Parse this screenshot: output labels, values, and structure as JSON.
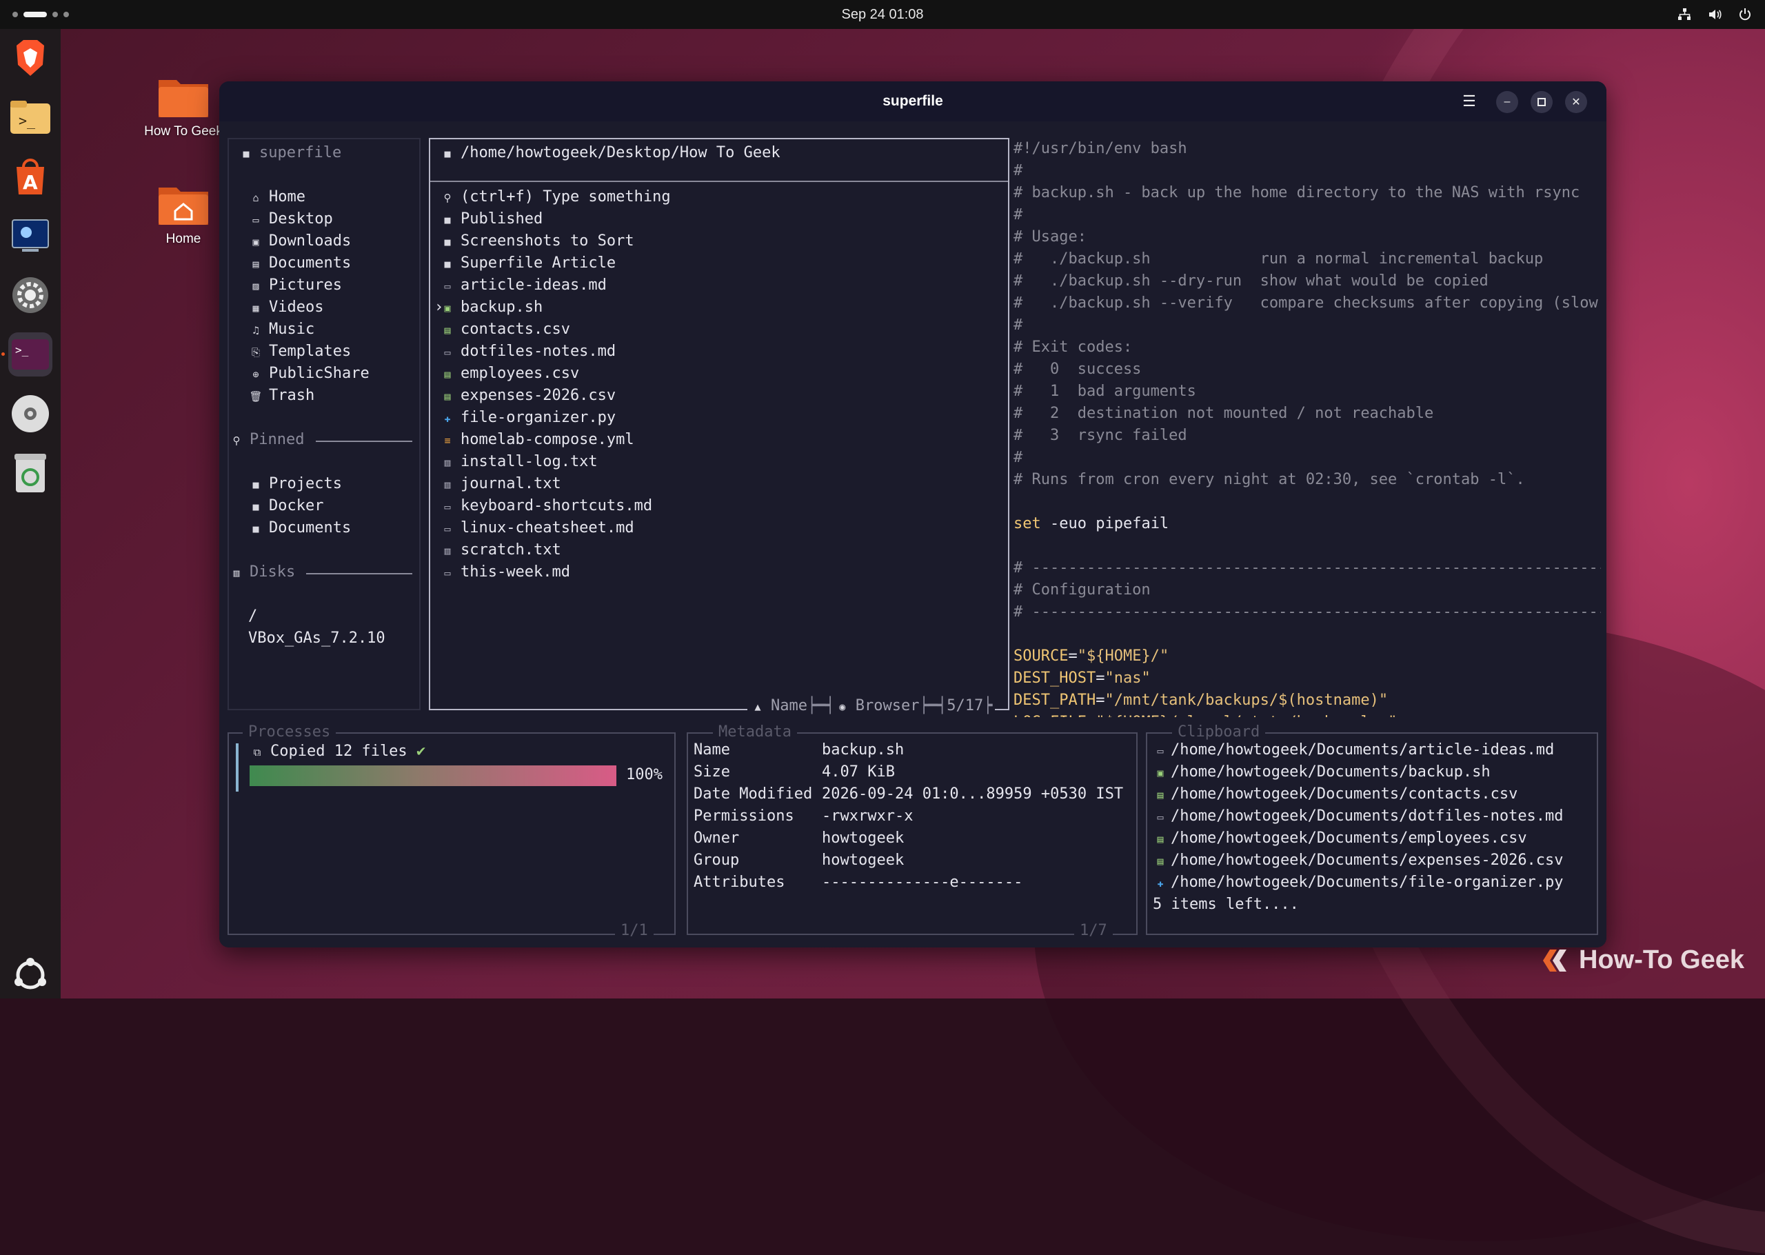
{
  "topbar": {
    "clock": "Sep 24  01:08"
  },
  "desktop": [
    {
      "label": "How To Geek"
    },
    {
      "label": "Home"
    }
  ],
  "window": {
    "title": "superfile"
  },
  "sidebar": {
    "title": "superfile",
    "items": [
      "Home",
      "Desktop",
      "Downloads",
      "Documents",
      "Pictures",
      "Videos",
      "Music",
      "Templates",
      "PublicShare",
      "Trash"
    ],
    "pinned_label": "Pinned",
    "pinned": [
      "Projects",
      "Docker",
      "Documents"
    ],
    "disks_label": "Disks",
    "disks": [
      "/",
      "VBox_GAs_7.2.10"
    ]
  },
  "browser": {
    "path": "/home/howtogeek/Desktop/How To Geek",
    "search_placeholder": "(ctrl+f) Type something",
    "files": [
      {
        "name": "Published",
        "icon": "folder"
      },
      {
        "name": "Screenshots to Sort",
        "icon": "folder"
      },
      {
        "name": "Superfile Article",
        "icon": "folder"
      },
      {
        "name": "article-ideas.md",
        "icon": "markdown"
      },
      {
        "name": "backup.sh",
        "icon": "script",
        "selected": true
      },
      {
        "name": "contacts.csv",
        "icon": "csv"
      },
      {
        "name": "dotfiles-notes.md",
        "icon": "markdown"
      },
      {
        "name": "employees.csv",
        "icon": "csv"
      },
      {
        "name": "expenses-2026.csv",
        "icon": "csv"
      },
      {
        "name": "file-organizer.py",
        "icon": "python"
      },
      {
        "name": "homelab-compose.yml",
        "icon": "yaml"
      },
      {
        "name": "install-log.txt",
        "icon": "text"
      },
      {
        "name": "journal.txt",
        "icon": "text"
      },
      {
        "name": "keyboard-shortcuts.md",
        "icon": "markdown"
      },
      {
        "name": "linux-cheatsheet.md",
        "icon": "markdown"
      },
      {
        "name": "scratch.txt",
        "icon": "text"
      },
      {
        "name": "this-week.md",
        "icon": "markdown"
      }
    ],
    "footer": {
      "sort": "Name",
      "mode": "Browser",
      "count": "5/17"
    }
  },
  "preview": {
    "lines": [
      {
        "t": "#!/usr/bin/env bash",
        "c": "comment"
      },
      {
        "t": "#",
        "c": "comment"
      },
      {
        "t": "# backup.sh - back up the home directory to the NAS with rsync",
        "c": "comment"
      },
      {
        "t": "#",
        "c": "comment"
      },
      {
        "t": "# Usage:",
        "c": "comment"
      },
      {
        "t": "#   ./backup.sh            run a normal incremental backup",
        "c": "comment"
      },
      {
        "t": "#   ./backup.sh --dry-run  show what would be copied",
        "c": "comment"
      },
      {
        "t": "#   ./backup.sh --verify   compare checksums after copying (slow",
        "c": "comment"
      },
      {
        "t": "#",
        "c": "comment"
      },
      {
        "t": "# Exit codes:",
        "c": "comment"
      },
      {
        "t": "#   0  success",
        "c": "comment"
      },
      {
        "t": "#   1  bad arguments",
        "c": "comment"
      },
      {
        "t": "#   2  destination not mounted / not reachable",
        "c": "comment"
      },
      {
        "t": "#   3  rsync failed",
        "c": "comment"
      },
      {
        "t": "#",
        "c": "comment"
      },
      {
        "t": "# Runs from cron every night at 02:30, see `crontab -l`.",
        "c": "comment"
      },
      {
        "t": "",
        "c": "plain"
      },
      {
        "t": "set -euo pipefail",
        "c": "set"
      },
      {
        "t": "",
        "c": "plain"
      },
      {
        "t": "# ---------------------------------------------------------------",
        "c": "comment"
      },
      {
        "t": "# Configuration",
        "c": "comment"
      },
      {
        "t": "# ---------------------------------------------------------------",
        "c": "comment"
      },
      {
        "t": "",
        "c": "plain"
      },
      {
        "t": "SOURCE=\"${HOME}/\"",
        "c": "assign"
      },
      {
        "t": "DEST_HOST=\"nas\"",
        "c": "assign"
      },
      {
        "t": "DEST_PATH=\"/mnt/tank/backups/$(hostname)\"",
        "c": "assign"
      },
      {
        "t": "LOG_FILE=\"${HOME}/.local/state/backup.log\"",
        "c": "assign"
      }
    ]
  },
  "processes": {
    "label": "Processes",
    "task": "Copied 12 files",
    "progress": 1.0,
    "progress_text": "100%",
    "footer": "1/1"
  },
  "metadata": {
    "label": "Metadata",
    "rows": [
      {
        "k": "Name",
        "v": "backup.sh"
      },
      {
        "k": "Size",
        "v": "4.07 KiB"
      },
      {
        "k": "Date Modified",
        "v": "2026-09-24 01:0...89959 +0530 IST"
      },
      {
        "k": "Permissions",
        "v": "-rwxrwxr-x"
      },
      {
        "k": "Owner",
        "v": "howtogeek"
      },
      {
        "k": "Group",
        "v": "howtogeek"
      },
      {
        "k": "Attributes",
        "v": "--------------e-------"
      }
    ],
    "footer": "1/7"
  },
  "clipboard": {
    "label": "Clipboard",
    "items": [
      {
        "t": "/home/howtogeek/Documents/article-ideas.md",
        "icon": "markdown"
      },
      {
        "t": "/home/howtogeek/Documents/backup.sh",
        "icon": "script"
      },
      {
        "t": "/home/howtogeek/Documents/contacts.csv",
        "icon": "csv"
      },
      {
        "t": "/home/howtogeek/Documents/dotfiles-notes.md",
        "icon": "markdown"
      },
      {
        "t": "/home/howtogeek/Documents/employees.csv",
        "icon": "csv"
      },
      {
        "t": "/home/howtogeek/Documents/expenses-2026.csv",
        "icon": "csv"
      },
      {
        "t": "/home/howtogeek/Documents/file-organizer.py",
        "icon": "python"
      }
    ],
    "more": "5 items left...."
  },
  "watermark": "How-To Geek",
  "colors": {
    "accent": "#e95420",
    "terminal_bg": "#1b1b2b",
    "border": "#4b4b5e"
  }
}
